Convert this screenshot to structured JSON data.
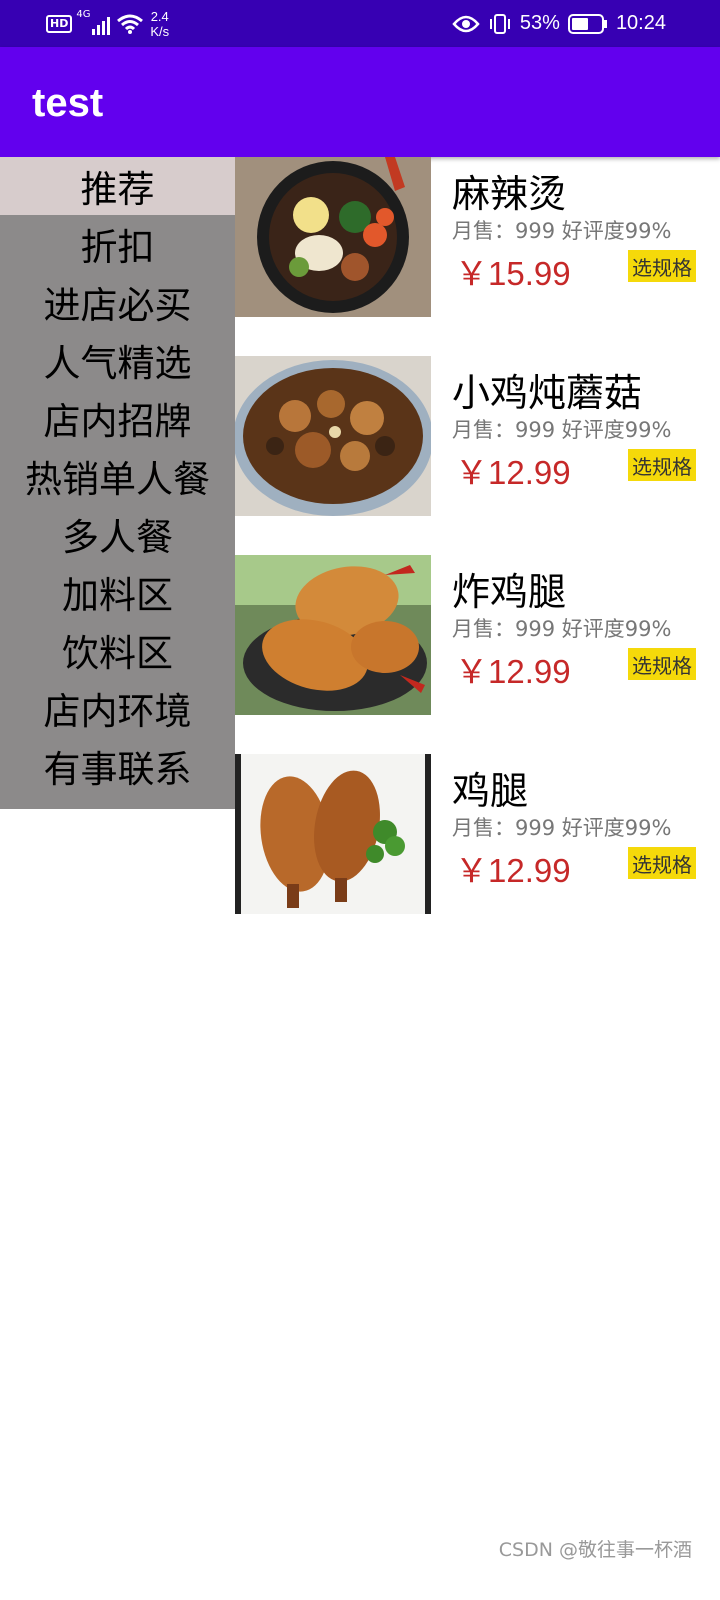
{
  "status_bar": {
    "hd": "HD",
    "network": "4G",
    "speed_value": "2.4",
    "speed_unit": "K/s",
    "battery": "53%",
    "time": "10:24"
  },
  "app_bar": {
    "title": "test"
  },
  "sidebar": {
    "items": [
      {
        "label": "推荐",
        "selected": true
      },
      {
        "label": "折扣",
        "selected": false
      },
      {
        "label": "进店必买",
        "selected": false
      },
      {
        "label": "人气精选",
        "selected": false
      },
      {
        "label": "店内招牌",
        "selected": false
      },
      {
        "label": "热销单人餐",
        "selected": false
      },
      {
        "label": "多人餐",
        "selected": false
      },
      {
        "label": "加料区",
        "selected": false
      },
      {
        "label": "饮料区",
        "selected": false
      },
      {
        "label": "店内环境",
        "selected": false
      },
      {
        "label": "有事联系",
        "selected": false
      }
    ]
  },
  "products": [
    {
      "name": "麻辣烫",
      "sales": "月售：999 好评度99%",
      "price": "￥15.99",
      "button": "选规格",
      "image": "malatang-photo"
    },
    {
      "name": "小鸡炖蘑菇",
      "sales": "月售：999 好评度99%",
      "price": "￥12.99",
      "button": "选规格",
      "image": "chicken-mushroom-stew-photo"
    },
    {
      "name": "炸鸡腿",
      "sales": "月售：999 好评度99%",
      "price": "￥12.99",
      "button": "选规格",
      "image": "fried-drumstick-photo"
    },
    {
      "name": "鸡腿",
      "sales": "月售：999 好评度99%",
      "price": "￥12.99",
      "button": "选规格",
      "image": "drumstick-photo"
    }
  ],
  "watermark": "CSDN @敬往事一杯酒",
  "colors": {
    "status_bar": "#3700b3",
    "app_bar": "#6200ee",
    "sidebar_bg": "#8c8a8a",
    "sidebar_selected": "#d7cccc",
    "price": "#c62828",
    "spec_button": "#f5d90a"
  }
}
